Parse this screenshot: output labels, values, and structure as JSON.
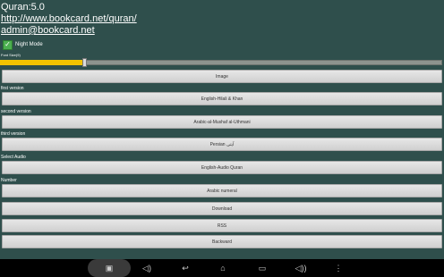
{
  "header": {
    "version": "Quran:5.0",
    "website": "http://www.bookcard.net/quran/",
    "email": "admin@bookcard.net"
  },
  "night_mode": {
    "label": "Night Mode",
    "checked": true
  },
  "font_size": {
    "label": "Font Size(9)",
    "value": 0.19
  },
  "buttons": {
    "image": "Image",
    "first": "English-Hilali & Khan",
    "second": "Arabic-al-Mushaf al-Uthmani",
    "third": "Persian  آیتی",
    "audio": "English-Audio Quran",
    "number": "Arabic numeral",
    "download": "Download",
    "rss": "RSS",
    "backward": "Backward"
  },
  "sections": {
    "first": "first version",
    "second": "second version",
    "third": "third version",
    "audio": "Select Audio",
    "number": "Number"
  },
  "nav_icons": [
    "screenshot-icon",
    "volume-down-icon",
    "back-icon",
    "home-icon",
    "recent-apps-icon",
    "volume-up-icon",
    "more-icon"
  ],
  "colors": {
    "background": "#2f4f4c",
    "slider_fill": "#f2c300",
    "checkbox": "#4caf50"
  }
}
